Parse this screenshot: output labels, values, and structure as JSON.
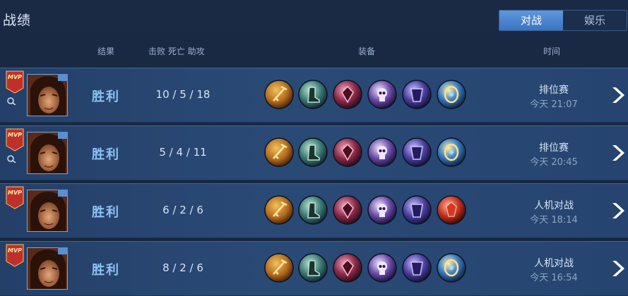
{
  "header": {
    "title": "战绩",
    "tabs": [
      {
        "label": "对战",
        "active": true
      },
      {
        "label": "娱乐",
        "active": false
      }
    ]
  },
  "columns": {
    "result": "结果",
    "kda": "击败 死亡 助攻",
    "equipment": "装备",
    "time": "时间"
  },
  "colors": {
    "accent": "#4a86d0",
    "result_text": "#8ec2f3",
    "mvp_badge": "#c0302a"
  },
  "matches": [
    {
      "mvp": "MVP",
      "result": "胜利",
      "kda": "10 / 5 / 18",
      "mode": "排位赛",
      "time": "今天 21:07",
      "items": [
        "golden-staff-icon",
        "green-boots-icon",
        "crimson-mask-icon",
        "skull-helm-icon",
        "violet-armor-icon",
        "gold-amulet-icon"
      ]
    },
    {
      "mvp": "MVP",
      "result": "胜利",
      "kda": "5 / 4 / 11",
      "mode": "排位赛",
      "time": "今天 20:45",
      "items": [
        "golden-staff-icon",
        "green-boots-icon",
        "crimson-mask-icon",
        "skull-helm-icon",
        "violet-armor-icon",
        "gold-amulet-icon"
      ]
    },
    {
      "mvp": "MVP",
      "result": "胜利",
      "kda": "6 / 2 / 6",
      "mode": "人机对战",
      "time": "今天 18:14",
      "items": [
        "golden-staff-icon",
        "green-boots-icon",
        "crimson-mask-icon",
        "skull-helm-icon",
        "violet-armor-icon",
        "red-gem-icon"
      ]
    },
    {
      "mvp": "MVP",
      "result": "胜利",
      "kda": "8 / 2 / 6",
      "mode": "人机对战",
      "time": "今天 16:54",
      "items": [
        "golden-staff-icon",
        "green-boots-icon",
        "crimson-mask-icon",
        "skull-helm-icon",
        "violet-armor-icon",
        "gold-amulet-icon"
      ]
    }
  ]
}
